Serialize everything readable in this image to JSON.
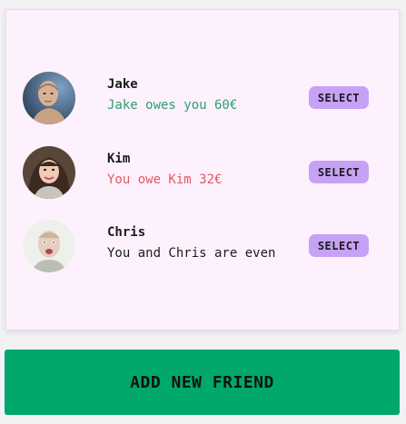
{
  "friends": [
    {
      "name": "Jake",
      "status_text": "Jake owes you 60€",
      "status_type": "owes-you",
      "select_label": "SELECT",
      "avatar_icon": "avatar-jake-icon"
    },
    {
      "name": "Kim",
      "status_text": "You owe Kim 32€",
      "status_type": "you-owe",
      "select_label": "SELECT",
      "avatar_icon": "avatar-kim-icon"
    },
    {
      "name": "Chris",
      "status_text": "You and Chris are even",
      "status_type": "even",
      "select_label": "SELECT",
      "avatar_icon": "avatar-chris-icon"
    }
  ],
  "add_friend_label": "ADD NEW FRIEND",
  "colors": {
    "card_bg": "#fdf1fd",
    "select_bg": "#c7a1f5",
    "add_bg": "#00a86b",
    "owes_you": "#2f9e6e",
    "you_owe": "#e05a64"
  }
}
